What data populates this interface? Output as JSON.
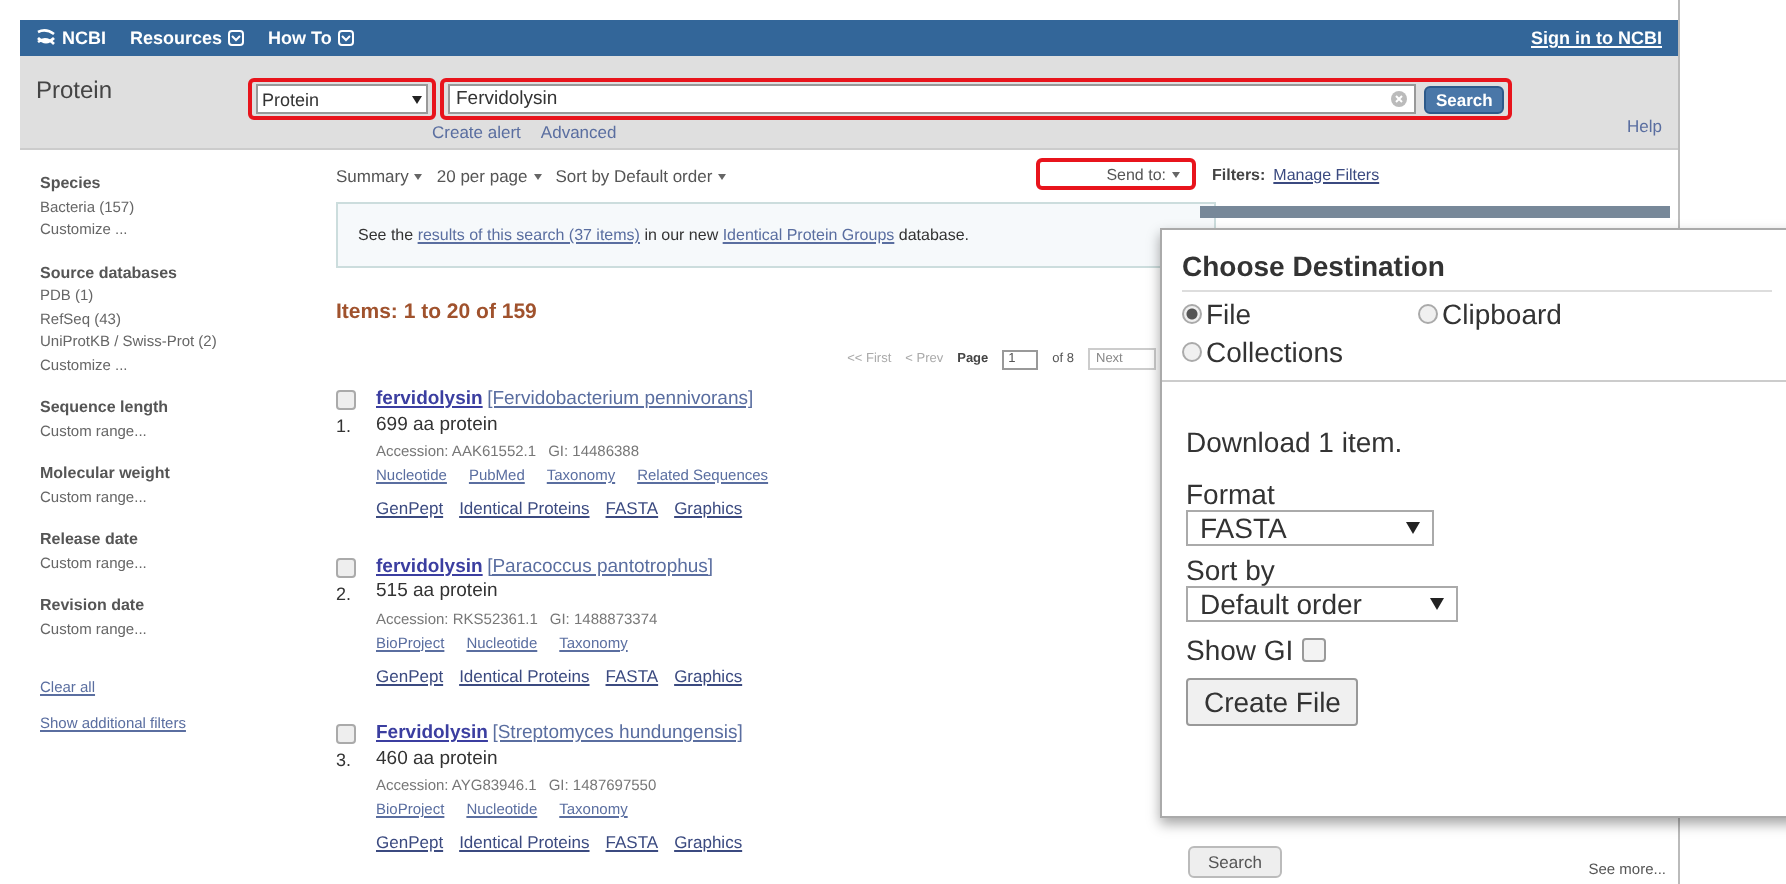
{
  "topbar": {
    "logo": "NCBI",
    "menus": [
      "Resources",
      "How To"
    ],
    "sign_in": "Sign in to NCBI"
  },
  "search": {
    "title": "Protein",
    "database": "Protein",
    "query": "Fervidolysin",
    "button": "Search",
    "links": [
      "Create alert",
      "Advanced"
    ],
    "help": "Help"
  },
  "sidebar": {
    "groups": [
      {
        "heading": "Species",
        "items": [
          "Bacteria (157)",
          "Customize ..."
        ]
      },
      {
        "heading": "Source databases",
        "items": [
          "PDB (1)",
          "RefSeq (43)",
          "UniProtKB / Swiss-Prot (2)",
          "Customize ..."
        ]
      },
      {
        "heading": "Sequence length",
        "items": [
          "Custom range..."
        ]
      },
      {
        "heading": "Molecular weight",
        "items": [
          "Custom range..."
        ]
      },
      {
        "heading": "Release date",
        "items": [
          "Custom range..."
        ]
      },
      {
        "heading": "Revision date",
        "items": [
          "Custom range..."
        ]
      }
    ],
    "links": [
      "Clear all",
      "Show additional filters"
    ]
  },
  "toolbar": {
    "menus": [
      "Summary",
      "20 per page",
      "Sort by Default order"
    ],
    "send_to": "Send to:",
    "filters_label": "Filters:",
    "manage_filters": "Manage Filters"
  },
  "notice": {
    "before": "See the",
    "link1": "results of this search (37 items)",
    "middle": "in our new",
    "link2": "Identical Protein Groups",
    "after": "database."
  },
  "items_heading": "Items: 1 to 20 of 159",
  "pager": {
    "first": "<< First",
    "prev": "< Prev",
    "page_label": "Page",
    "page": "1",
    "of": "of 8",
    "next": "Next"
  },
  "results": [
    {
      "number": "1.",
      "checked": false,
      "name": "fervidolysin",
      "organism": "[Fervidobacterium pennivorans]",
      "length": "699 aa protein",
      "accession": "Accession: AAK61552.1",
      "gi": "GI: 14486388",
      "links": [
        "Nucleotide",
        "PubMed",
        "Taxonomy",
        "Related Sequences"
      ],
      "tools": [
        "GenPept",
        "Identical Proteins",
        "FASTA",
        "Graphics"
      ]
    },
    {
      "number": "2.",
      "checked": false,
      "name": "fervidolysin",
      "organism": "[Paracoccus pantotrophus]",
      "length": "515 aa protein",
      "accession": "Accession: RKS52361.1",
      "gi": "GI: 1488873374",
      "links": [
        "BioProject",
        "Nucleotide",
        "Taxonomy"
      ],
      "tools": [
        "GenPept",
        "Identical Proteins",
        "FASTA",
        "Graphics"
      ]
    },
    {
      "number": "3.",
      "checked": false,
      "name": "Fervidolysin",
      "organism": "[Streptomyces hundungensis]",
      "length": "460 aa protein",
      "accession": "Accession: AYG83946.1",
      "gi": "GI: 1487697550",
      "links": [
        "BioProject",
        "Nucleotide",
        "Taxonomy"
      ],
      "tools": [
        "GenPept",
        "Identical Proteins",
        "FASTA",
        "Graphics"
      ]
    }
  ],
  "right_column": {
    "button": "Search",
    "see_more": "See more..."
  },
  "popup": {
    "title": "Choose Destination",
    "destinations": [
      {
        "label": "File",
        "selected": true
      },
      {
        "label": "Clipboard",
        "selected": false
      },
      {
        "label": "Collections",
        "selected": false
      }
    ],
    "download": "Download 1 item.",
    "format_label": "Format",
    "format": "FASTA",
    "sort_label": "Sort by",
    "sort": "Default order",
    "show_gi_label": "Show GI",
    "show_gi": false,
    "button": "Create File"
  }
}
